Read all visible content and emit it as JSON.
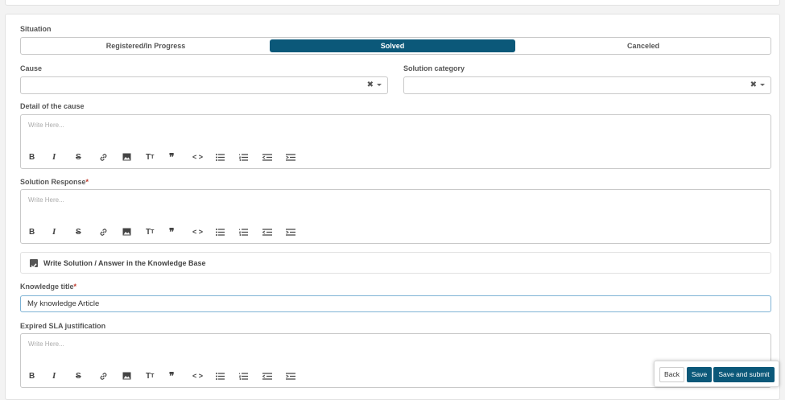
{
  "situation": {
    "label": "Situation",
    "options": [
      "Registered/In Progress",
      "Solved",
      "Canceled"
    ],
    "selected": "Solved"
  },
  "cause": {
    "label": "Cause",
    "value": ""
  },
  "solution_category": {
    "label": "Solution category",
    "value": ""
  },
  "select_clear": "✖",
  "detail": {
    "label": "Detail of the cause",
    "placeholder": "Write Here..."
  },
  "solution_response": {
    "label": "Solution Response",
    "required_mark": "*",
    "placeholder": "Write Here..."
  },
  "knowledge_base": {
    "checked": true,
    "label": "Write Solution / Answer in the Knowledge Base"
  },
  "knowledge_title": {
    "label": "Knowledge title",
    "required_mark": "*",
    "value": "My knowledge Article"
  },
  "expired_sla": {
    "label": "Expired SLA justification",
    "placeholder": "Write Here..."
  },
  "toolbar_icons": [
    "bold-icon",
    "italic-icon",
    "strikethrough-icon",
    "link-icon",
    "image-icon",
    "text-size-icon",
    "quote-icon",
    "code-icon",
    "bulleted-list-icon",
    "numbered-list-icon",
    "outdent-icon",
    "indent-icon"
  ],
  "actions": {
    "back": "Back",
    "save": "Save",
    "submit": "Save and submit"
  },
  "colors": {
    "primary": "#0b5879",
    "required": "#c0392b",
    "focus_border": "#7fb3d5"
  }
}
